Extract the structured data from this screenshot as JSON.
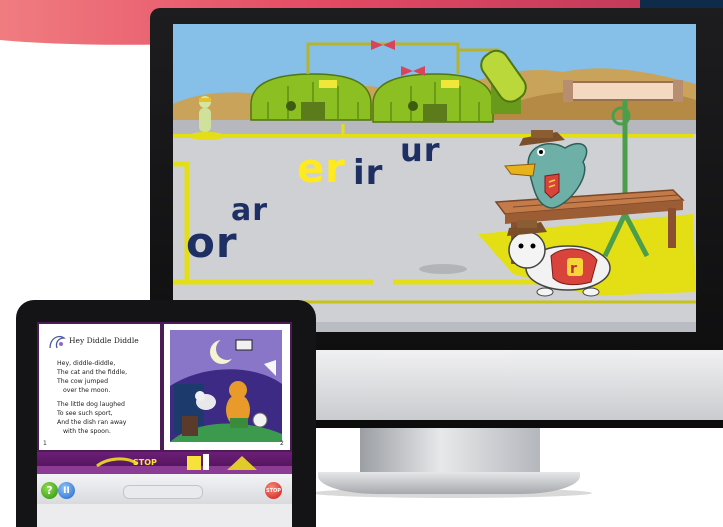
{
  "game": {
    "phonograms": [
      "or",
      "ar",
      "er",
      "ir",
      "ur"
    ],
    "highlighted": "er",
    "character_badge": "r",
    "colors": {
      "sky": "#7fb9e6",
      "highlight": "#ffea1e",
      "text": "#1d2f63",
      "hut": "#8cbf22",
      "mat": "#e3df14"
    }
  },
  "book": {
    "title": "Hey Diddle Diddle",
    "stanza1": [
      "Hey, diddle-diddle,",
      "The cat and the fiddle,",
      "The cow jumped",
      "over the moon."
    ],
    "stanza2": [
      "The little dog laughed",
      "To see such sport,",
      "And the dish ran away",
      "with the spoon."
    ],
    "page_left": "1",
    "page_right": "2",
    "banner_label": "STOP"
  },
  "controls": {
    "help_label": "?",
    "pause_label": "II",
    "stop_label": "STOP",
    "progress": 0,
    "colors": {
      "help": "#35a11c",
      "pause": "#2a73d6",
      "stop": "#d22a1e"
    }
  }
}
